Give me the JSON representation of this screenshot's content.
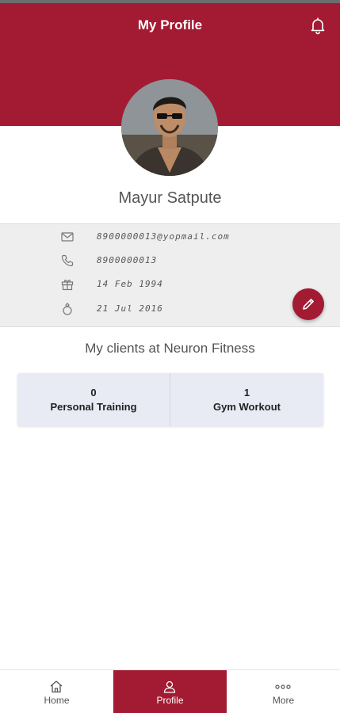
{
  "header": {
    "title": "My Profile",
    "bell_icon": "bell-icon",
    "color": "#a31b32"
  },
  "profile": {
    "name": "Mayur Satpute",
    "email": "8900000013@yopmail.com",
    "phone": "8900000013",
    "birthday": "14 Feb 1994",
    "anniversary": "21 Jul 2016",
    "edit_icon": "pencil-icon"
  },
  "clients": {
    "title": "My clients at Neuron Fitness",
    "items": [
      {
        "count": "0",
        "label": "Personal Training"
      },
      {
        "count": "1",
        "label": "Gym Workout"
      }
    ]
  },
  "bottom_nav": {
    "items": [
      {
        "label": "Home",
        "icon": "home-icon",
        "active": false
      },
      {
        "label": "Profile",
        "icon": "user-icon",
        "active": true
      },
      {
        "label": "More",
        "icon": "more-icon",
        "active": false
      }
    ]
  }
}
